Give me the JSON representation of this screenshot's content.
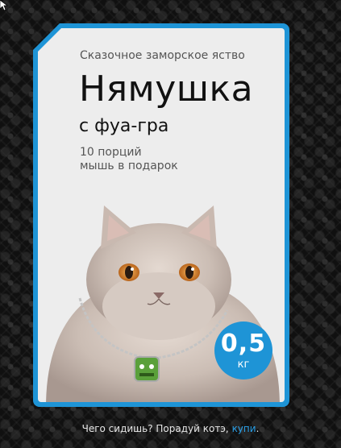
{
  "product": {
    "tagline": "Сказочное заморское яство",
    "name": "Нямушка",
    "flavor": "с фуа-гра",
    "portions": "10 порций",
    "gift": "мышь в подарок"
  },
  "weight": {
    "value": "0,5",
    "unit": "кг"
  },
  "footer": {
    "text": "Чего сидишь? Порадуй котэ, ",
    "link": "купи",
    "punct": "."
  },
  "colors": {
    "accent": "#1e94d6",
    "card": "#ededed",
    "link": "#2aa0e8"
  },
  "icons": {
    "cursor": "cursor-icon",
    "cat": "cat-photo",
    "tag": "pet-tag-icon"
  }
}
